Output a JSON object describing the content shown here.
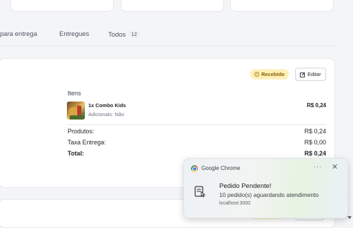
{
  "tabs": [
    {
      "label": "para entrega"
    },
    {
      "label": "Entregues"
    },
    {
      "label": "Todos",
      "count": "12"
    }
  ],
  "order": {
    "status": "Recebido",
    "edit_label": "Editar",
    "items_title": "Itens",
    "items": [
      {
        "name": "1x Combo Kids",
        "extras": "Adicionais: Não",
        "price": "R$ 0,24"
      }
    ],
    "summary": {
      "products_label": "Produtos:",
      "products_value": "R$ 0,24",
      "delivery_label": "Taxa Entrega:",
      "delivery_value": "R$ 0,00",
      "total_label": "Total:",
      "total_value": "R$ 0,24"
    }
  },
  "notification": {
    "app_name": "Google Chrome",
    "more_label": "···",
    "close_label": "✕",
    "title": "Pedido Pendente!",
    "body": "10 pedido(s) aguardando atendimento",
    "origin": "localhost:3000"
  },
  "colors": {
    "status_badge_bg": "#fdf1b8",
    "status_badge_text": "#8a5a00"
  }
}
